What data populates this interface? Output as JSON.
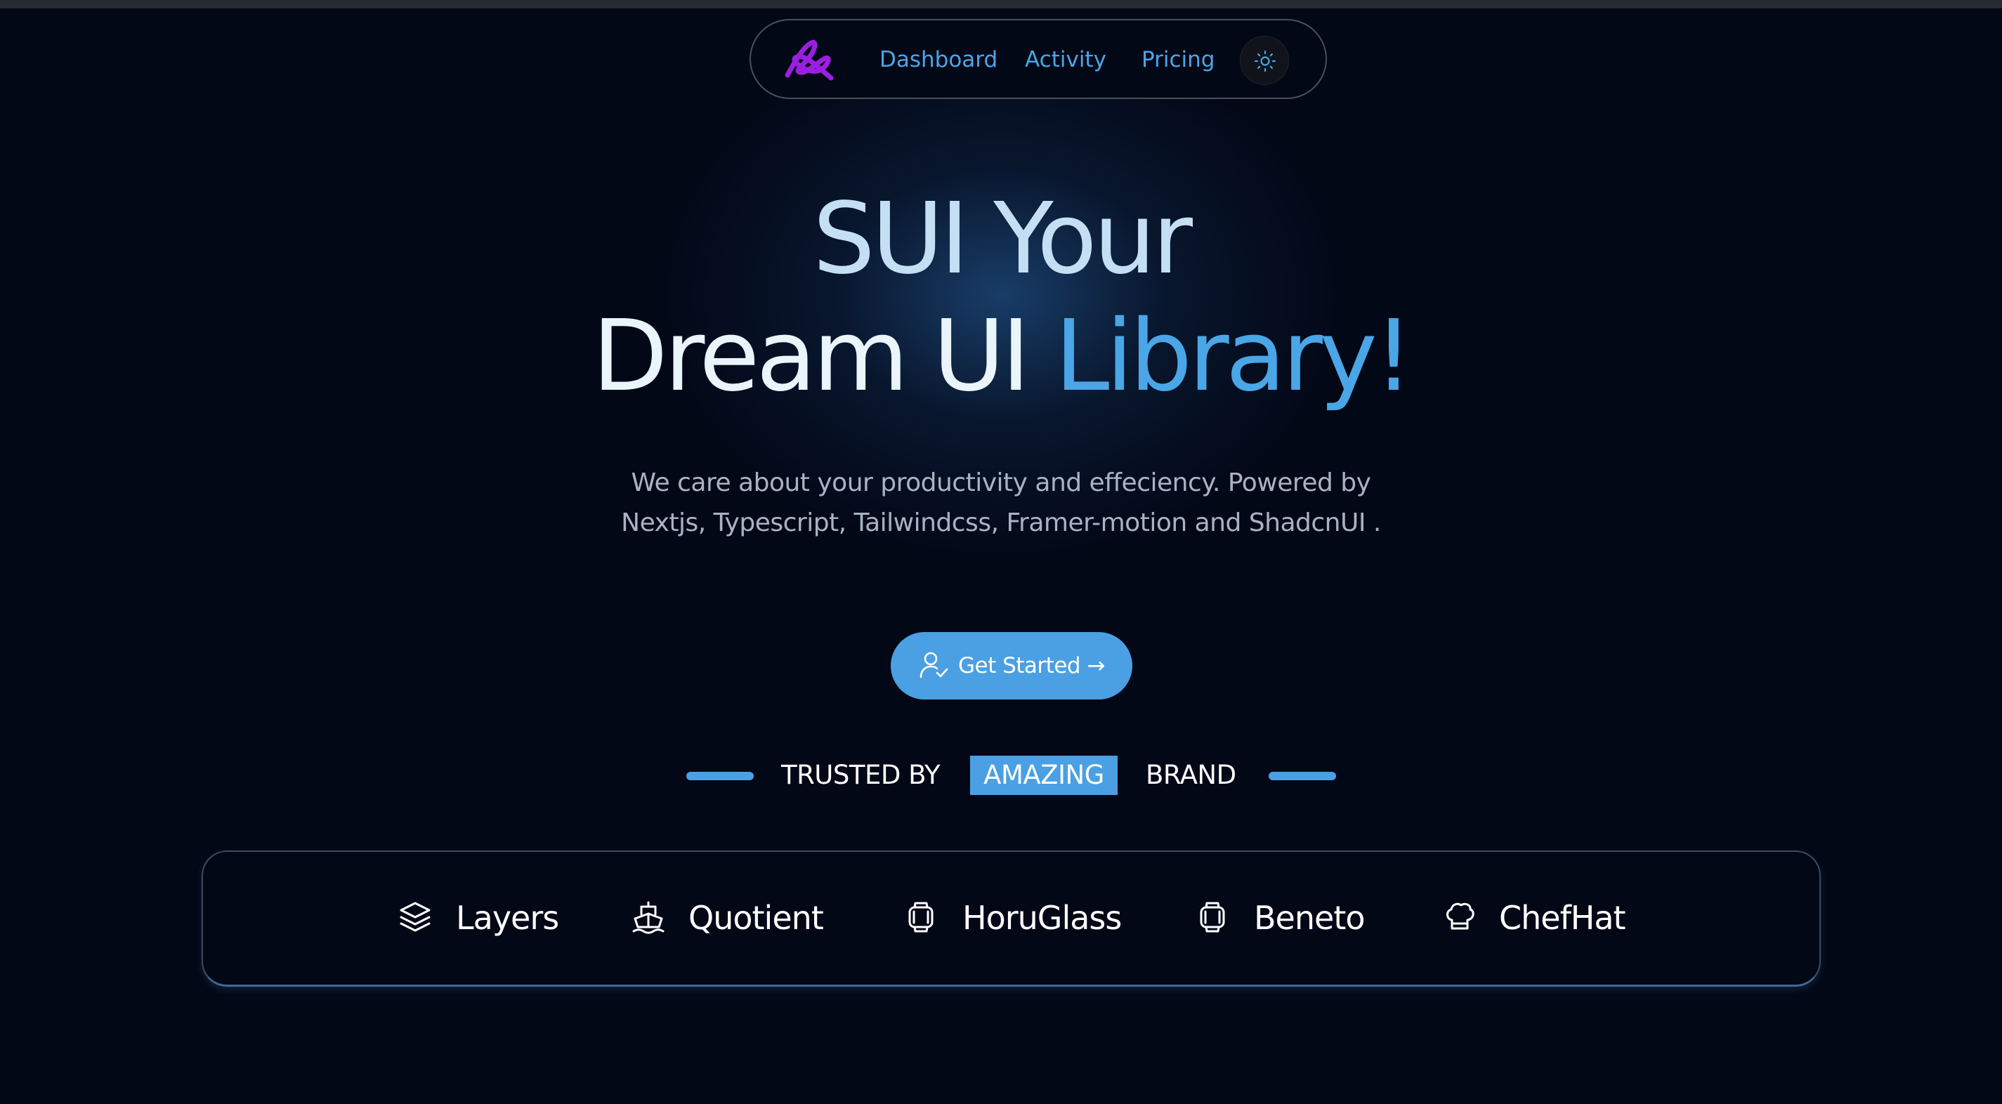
{
  "nav": {
    "links": [
      {
        "label": "Dashboard"
      },
      {
        "label": "Activity"
      },
      {
        "label": "Pricing"
      }
    ],
    "logo_icon": "swirl-logo-icon",
    "theme_icon": "sun-icon"
  },
  "hero": {
    "line1": "SUI Your",
    "line2_prefix": "Dream UI ",
    "line2_accent": "Library!",
    "subtitle_line1": "We care about your productivity and effeciency. Powered by",
    "subtitle_line2": "Nextjs, Typescript, Tailwindcss, Framer-motion and ShadcnUI ."
  },
  "cta": {
    "label": "Get Started →",
    "icon": "user-check-icon"
  },
  "trusted": {
    "part1": "TRUSTED BY",
    "highlight": "AMAZING",
    "part3": "BRAND"
  },
  "brands": [
    {
      "name": "Layers",
      "icon": "layers-icon"
    },
    {
      "name": "Quotient",
      "icon": "ship-icon"
    },
    {
      "name": "HoruGlass",
      "icon": "watch-icon"
    },
    {
      "name": "Beneto",
      "icon": "watch-icon"
    },
    {
      "name": "ChefHat",
      "icon": "chef-hat-icon"
    }
  ],
  "colors": {
    "background": "#030817",
    "accent": "#4aa6e6",
    "logo": "#9b1fe0",
    "text": "#ffffff",
    "subtitle": "#a9b3c1"
  }
}
